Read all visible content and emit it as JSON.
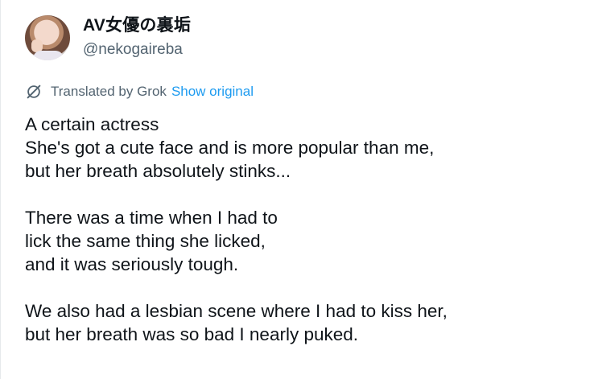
{
  "user": {
    "display_name": "AV女優の裏垢",
    "handle": "@nekogaireba"
  },
  "translation": {
    "label": "Translated by Grok",
    "show_original": "Show original",
    "icon": "translate-slash-icon"
  },
  "tweet": {
    "paragraphs": [
      [
        "A certain actress",
        "She's got a cute face and is more popular than me,",
        "but her breath absolutely stinks..."
      ],
      [
        "There was a time when I had to",
        "lick the same thing she licked,",
        "and it was seriously tough."
      ],
      [
        "We also had a lesbian scene where I had to kiss her,",
        "but her breath was so bad I nearly puked."
      ]
    ]
  },
  "colors": {
    "text": "#0f1419",
    "secondary": "#536471",
    "link": "#1d9bf0"
  }
}
